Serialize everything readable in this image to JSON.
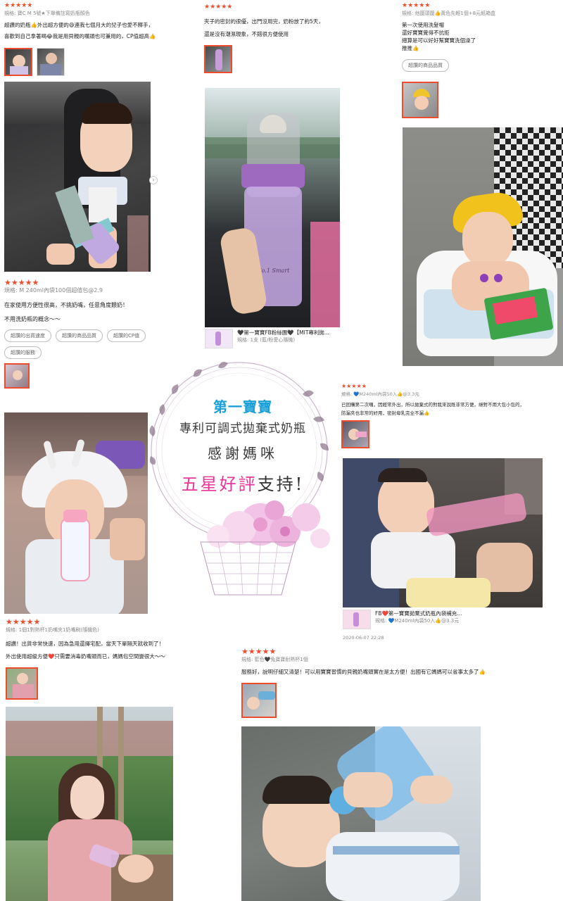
{
  "banner": {
    "brand": "第一寶寶",
    "subtitle": "專利可調式拋棄式奶瓶",
    "thanks": "感謝媽咪",
    "five_star": "五星好評",
    "support": "支持!"
  },
  "reviews": {
    "r1": {
      "stars": "★★★★★",
      "meta": "規格: 寶C M 5號★下單備註寫奶瓶顏色",
      "lines": [
        "超讚的奶瓶👍外出超方便的😄連我七個月大的兒子也愛不釋手，",
        "喜歡到自己拿著喝😂我是用貝親的嘴頭也可兼用的，CP值超高👍"
      ]
    },
    "r2": {
      "stars": "★★★★★",
      "meta": "規格: M 240ml內袋100個超值包@2.9",
      "lines": [
        "在家使用方便性很高，不挑奶嘴，任意角度餵奶！",
        "不用洗奶瓶的概念～～"
      ],
      "tags": [
        "超讚的出貨速度",
        "超讚的商品品質",
        "超讚的CP值",
        "超讚的服務"
      ]
    },
    "r3": {
      "stars": "★★★★★",
      "lines": [
        "夾子的密封的很優，出門沒用完，奶粉放了約5天，",
        "還是沒有潮濕現象，不錯很方便使用"
      ],
      "product_title": "🖤第一寶寶FB粉絲團🖤【MIT專利拋...",
      "product_spec": "規格: 1支 (藍/粉愛心隨機)"
    },
    "r4": {
      "stars": "★★★★★",
      "meta": "規格: 他圍頭圍👍黃色先輕1個+8元紙箱盒",
      "lines": [
        "第一次使用洗髮帽",
        "還好寶寶覺得不抗拒",
        "總算是可以好好幫寶寶洗個澡了",
        "推推👍"
      ],
      "tags": [
        "超讚的商品品質"
      ]
    },
    "r5": {
      "stars": "★★★★★",
      "meta": "規格: 1個1對熱杯1奶嘴夾1奶嘴刷(隨機色)",
      "lines": [
        "超讚！出貨非常快速，因為急用還擇宅配，當天下單隔天就收到了！",
        "外出使用超級方便❤️只需要消毒奶嘴頭而已，媽媽包空間變很大～～"
      ]
    },
    "r6": {
      "stars": "★★★★★",
      "meta": "規格: 💙M240ml內袋50入👍@3.3元",
      "lines": [
        "已回購第二次囉，因經常外出，所以拋棄式的對我來說既非常方便，絕對不用大包小包的，",
        "防漏夾也非常的好用，密封母乳完全不漏👍"
      ],
      "product_title": "FB❤️第一寶寶拋棄式奶瓶內袋補充...",
      "product_spec": "規格: 💙M240ml內袋50入👍@3.3元",
      "date": "2020-06-07 22:28"
    },
    "r7": {
      "stars": "★★★★★",
      "meta": "規格: 藍色🖤兔寶寶耐熱杯1個",
      "lines": [
        "服務好，說明仔細又清楚！可以用寶寶習慣的貝親奶嘴頭實在是太方便！出國有它媽媽可以省事太多了👍"
      ]
    }
  },
  "bottle_label": "No.1 Smart"
}
